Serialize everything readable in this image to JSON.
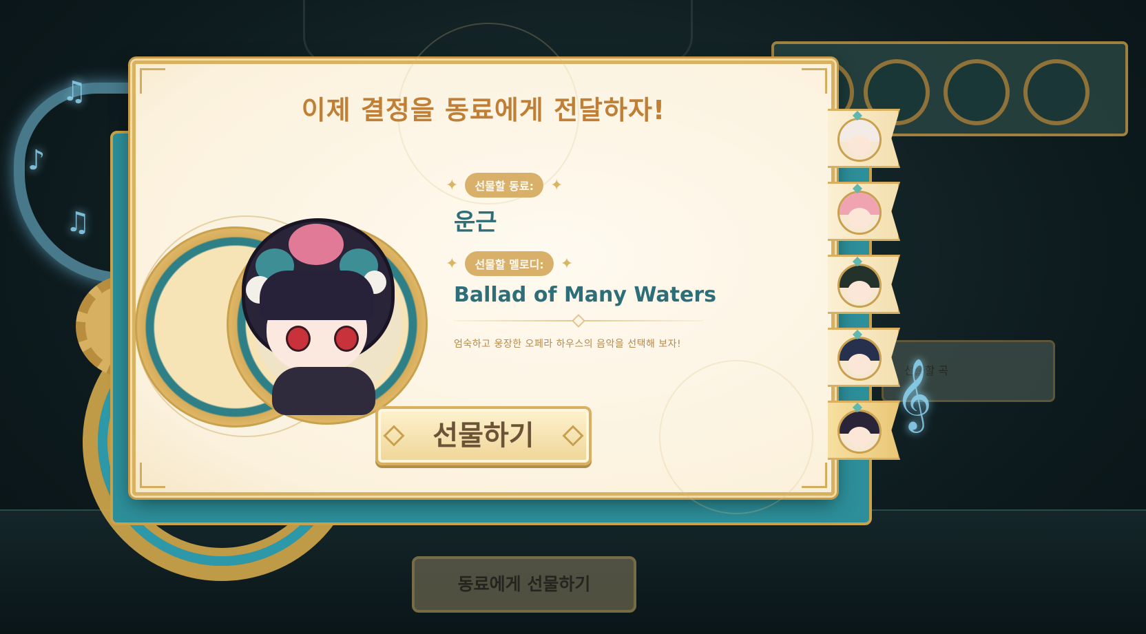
{
  "dialog": {
    "title": "이제 결정을 동료에게 전달하자!",
    "companion_label": "선물할 동료:",
    "companion_name": "운근",
    "melody_label": "선물할 멜로디:",
    "melody_name": "Ballad of Many Waters",
    "description": "엄숙하고 웅장한 오페라 하우스의 음악을 선택해 보자!",
    "gift_button": "선물하기"
  },
  "background": {
    "side_label": "선물할 곡",
    "bottom_button": "동료에게 선물하기"
  },
  "tabs": [
    {
      "name": "companion-1",
      "hair_color": "#f3ece6",
      "selected": false
    },
    {
      "name": "companion-2",
      "hair_color": "#f0a3b0",
      "selected": false
    },
    {
      "name": "companion-3",
      "hair_color": "#23322a",
      "selected": false
    },
    {
      "name": "companion-4",
      "hair_color": "#27304c",
      "selected": false
    },
    {
      "name": "companion-5",
      "hair_color": "#2a2438",
      "selected": true
    }
  ],
  "colors": {
    "title": "#c07f36",
    "value_text": "#2d6e78",
    "pill_bg": "#d9b06a"
  }
}
